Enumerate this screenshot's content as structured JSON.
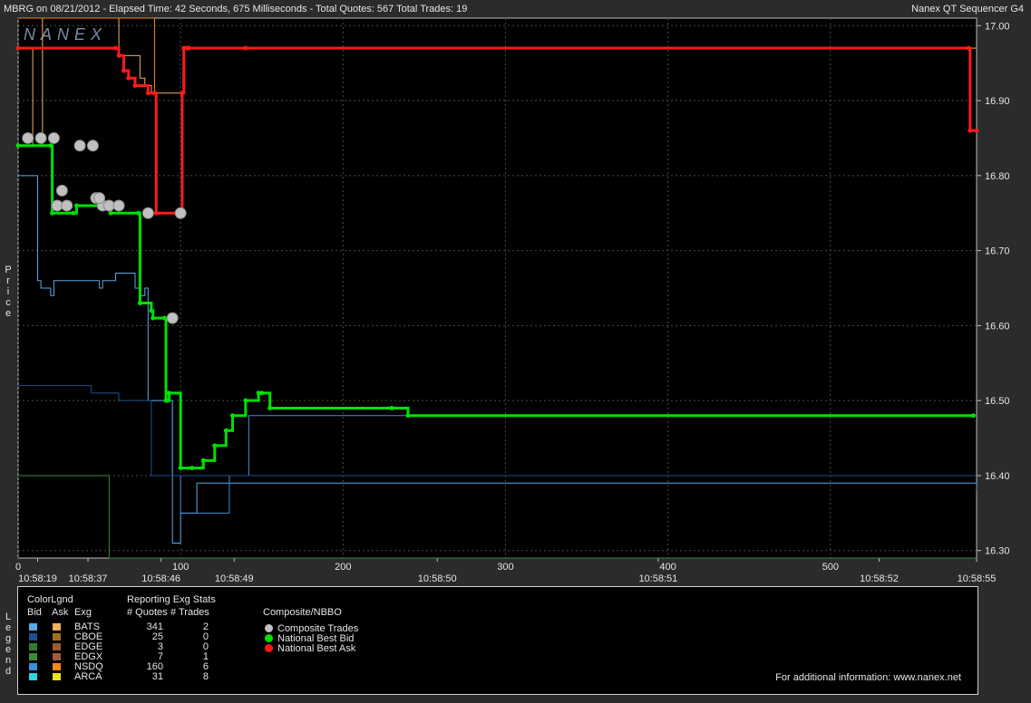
{
  "header": {
    "left": "MBRG on 08/21/2012  -  Elapsed Time: 42 Seconds, 675 Milliseconds  -  Total Quotes: 567  Total Trades: 19",
    "right": "Nanex QT Sequencer G4",
    "watermark": "NANEX"
  },
  "axis": {
    "ylabel_chars": [
      "P",
      "r",
      "i",
      "c",
      "e"
    ],
    "ylim": [
      16.29,
      17.01
    ],
    "yticks": [
      "17.00",
      "16.90",
      "16.80",
      "16.70",
      "16.60",
      "16.50",
      "16.40",
      "16.30"
    ],
    "xlim": [
      0,
      590
    ],
    "xticks": [
      "0",
      "100",
      "200",
      "300",
      "400",
      "500"
    ],
    "time_labels": [
      {
        "seq": 12,
        "label": "10:58:19"
      },
      {
        "seq": 43,
        "label": "10:58:37"
      },
      {
        "seq": 88,
        "label": "10:58:46"
      },
      {
        "seq": 133,
        "label": "10:58:49"
      },
      {
        "seq": 258,
        "label": "10:58:50"
      },
      {
        "seq": 394,
        "label": "10:58:51"
      },
      {
        "seq": 530,
        "label": "10:58:52"
      },
      {
        "seq": 590,
        "label": "10:58:55"
      }
    ]
  },
  "chart_data": {
    "type": "line",
    "title": "",
    "xlabel": "",
    "ylabel": "Price",
    "x_units": "quote sequence number",
    "ylim": [
      16.29,
      17.01
    ],
    "grid": true,
    "series": [
      {
        "name": "Composite Trades",
        "kind": "scatter",
        "x": [
          6,
          14,
          22,
          38,
          46,
          24,
          30,
          27,
          48,
          52,
          50,
          56,
          62,
          80,
          100,
          95
        ],
        "y": [
          16.85,
          16.85,
          16.85,
          16.84,
          16.84,
          16.76,
          16.76,
          16.78,
          16.77,
          16.76,
          16.77,
          16.76,
          16.76,
          16.75,
          16.75,
          16.61
        ]
      },
      {
        "name": "National Best Bid",
        "kind": "step",
        "x": [
          0,
          20,
          21,
          34,
          36,
          56,
          57,
          74,
          75,
          82,
          83,
          90,
          91,
          92,
          93,
          100,
          107,
          114,
          121,
          128,
          132,
          140,
          148,
          150,
          155,
          230,
          240,
          588
        ],
        "y": [
          16.84,
          16.84,
          16.75,
          16.75,
          16.76,
          16.76,
          16.75,
          16.75,
          16.63,
          16.62,
          16.61,
          16.61,
          16.5,
          16.5,
          16.51,
          16.41,
          16.41,
          16.42,
          16.44,
          16.46,
          16.48,
          16.5,
          16.51,
          16.51,
          16.49,
          16.49,
          16.48,
          16.48
        ]
      },
      {
        "name": "National Best Ask",
        "kind": "step",
        "x": [
          0,
          60,
          62,
          65,
          68,
          72,
          80,
          84,
          85,
          100,
          101,
          102,
          104,
          105,
          140,
          585,
          586,
          590
        ],
        "y": [
          16.97,
          16.97,
          16.96,
          16.94,
          16.93,
          16.92,
          16.91,
          16.91,
          16.75,
          16.75,
          16.91,
          16.97,
          16.97,
          16.97,
          16.97,
          16.97,
          16.86,
          16.86
        ]
      },
      {
        "name": "BATS bid",
        "kind": "step",
        "x": [
          0,
          10,
          12,
          14,
          20,
          22,
          48,
          50,
          52,
          58,
          60,
          70,
          72,
          75,
          78,
          80,
          92,
          95,
          97,
          100,
          110,
          140,
          585,
          590
        ],
        "y": [
          16.8,
          16.8,
          16.66,
          16.65,
          16.64,
          16.66,
          16.66,
          16.65,
          16.66,
          16.66,
          16.67,
          16.67,
          16.65,
          16.64,
          16.65,
          16.5,
          16.5,
          16.31,
          16.31,
          16.35,
          16.39,
          16.39,
          16.39,
          16.38
        ]
      },
      {
        "name": "NSDQ bid",
        "kind": "step",
        "x": [
          0,
          20,
          21,
          34,
          36,
          56,
          57,
          74,
          75,
          82,
          83,
          90,
          91,
          95,
          100,
          130,
          140,
          142,
          590
        ],
        "y": [
          16.84,
          16.84,
          16.75,
          16.75,
          16.76,
          16.76,
          16.75,
          16.75,
          16.63,
          16.62,
          16.61,
          16.61,
          16.5,
          16.4,
          16.35,
          16.4,
          16.4,
          16.48,
          16.48
        ]
      },
      {
        "name": "CBOE bid",
        "kind": "step",
        "x": [
          0,
          40,
          45,
          60,
          62,
          80,
          82,
          590
        ],
        "y": [
          16.52,
          16.52,
          16.51,
          16.51,
          16.5,
          16.5,
          16.4,
          16.4
        ]
      },
      {
        "name": "EDGX bid",
        "kind": "step",
        "x": [
          0,
          55,
          56,
          590
        ],
        "y": [
          16.4,
          16.4,
          16.29,
          16.29
        ]
      },
      {
        "name": "BATS ask",
        "kind": "step",
        "x": [
          0,
          8,
          9,
          14,
          15,
          60,
          62,
          75,
          78,
          82,
          90,
          100,
          102,
          590
        ],
        "y": [
          16.97,
          16.97,
          16.84,
          16.84,
          17.01,
          17.01,
          16.96,
          16.93,
          16.92,
          16.91,
          16.91,
          16.91,
          16.97,
          16.97
        ]
      },
      {
        "name": "NSDQ ask",
        "kind": "step",
        "x": [
          0,
          80,
          84,
          85,
          100,
          101,
          102,
          590
        ],
        "y": [
          17.01,
          17.01,
          16.91,
          16.75,
          16.75,
          16.91,
          16.97,
          16.97
        ]
      }
    ]
  },
  "legend": {
    "colorlgnd": "ColorLgnd",
    "bid": "Bid",
    "ask": "Ask",
    "exg": "Exg",
    "stats_title": "Reporting Exg Stats",
    "quotes_hdr": "# Quotes",
    "trades_hdr": "# Trades",
    "composite_title": "Composite/NBBO",
    "rows": [
      {
        "exg": "BATS",
        "quotes": "341",
        "trades": "2",
        "bid_color": "#5aa9e6",
        "ask_color": "#f0b060"
      },
      {
        "exg": "CBOE",
        "quotes": "25",
        "trades": "0",
        "bid_color": "#1f4e8c",
        "ask_color": "#a0701f"
      },
      {
        "exg": "EDGE",
        "quotes": "3",
        "trades": "0",
        "bid_color": "#2e7d32",
        "ask_color": "#9c5a3a"
      },
      {
        "exg": "EDGX",
        "quotes": "7",
        "trades": "1",
        "bid_color": "#3a8a3a",
        "ask_color": "#a05a3a"
      },
      {
        "exg": "NSDQ",
        "quotes": "160",
        "trades": "6",
        "bid_color": "#3b8fd8",
        "ask_color": "#f08a1a"
      },
      {
        "exg": "ARCA",
        "quotes": "31",
        "trades": "8",
        "bid_color": "#2ad6e6",
        "ask_color": "#f0e01a"
      }
    ],
    "composite": [
      {
        "label": "Composite Trades",
        "color": "#c0c0c0"
      },
      {
        "label": "National Best Bid",
        "color": "#00e000"
      },
      {
        "label": "National Best Ask",
        "color": "#ff1a1a"
      }
    ],
    "footer": "For additional information: www.nanex.net",
    "side_chars": [
      "L",
      "e",
      "g",
      "e",
      "n",
      "d"
    ]
  }
}
